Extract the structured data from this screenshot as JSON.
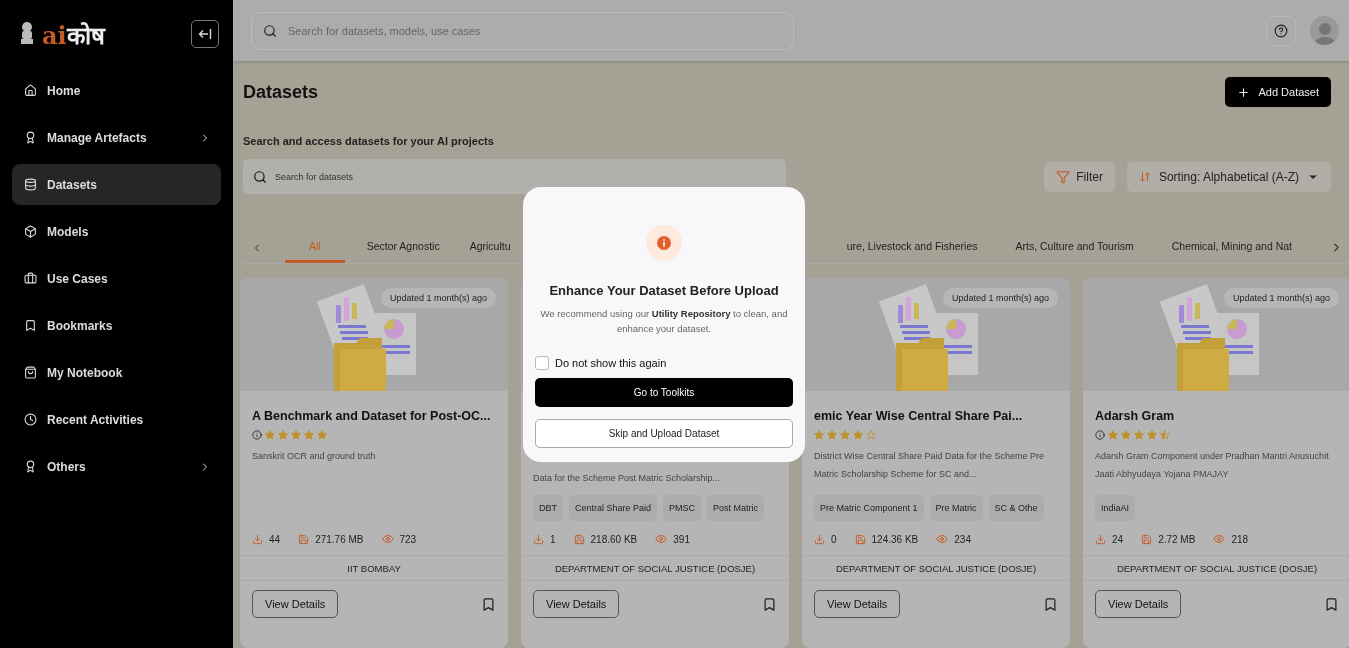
{
  "logo": {
    "prefix": "ai",
    "suffix": "कोष"
  },
  "sidebar": {
    "items": [
      {
        "label": "Home",
        "submenu": false,
        "selected": false
      },
      {
        "label": "Manage Artefacts",
        "submenu": true,
        "selected": false
      },
      {
        "label": "Datasets",
        "submenu": false,
        "selected": true
      },
      {
        "label": "Models",
        "submenu": false,
        "selected": false
      },
      {
        "label": "Use Cases",
        "submenu": false,
        "selected": false
      },
      {
        "label": "Bookmarks",
        "submenu": false,
        "selected": false
      },
      {
        "label": "My Notebook",
        "submenu": false,
        "selected": false
      },
      {
        "label": "Recent Activities",
        "submenu": false,
        "selected": false
      },
      {
        "label": "Others",
        "submenu": true,
        "selected": false
      }
    ]
  },
  "topbar": {
    "search": {
      "placeholder": "Search for datasets, models, use cases"
    }
  },
  "page": {
    "title": "Datasets",
    "subtitle": "Search and access datasets for your AI projects",
    "add_button": "Add Dataset",
    "search": {
      "placeholder": "Search for datasets"
    },
    "filter_button": "Filter",
    "sorting": {
      "label": "Sorting:",
      "value": "Alphabetical (A-Z)"
    }
  },
  "tabs": {
    "left": [
      {
        "label": "All",
        "selected": true
      },
      {
        "label": "Sector Agnostic",
        "selected": false
      },
      {
        "label": "Agricultu",
        "selected": false
      }
    ],
    "right": [
      {
        "label": "ure, Livestock and Fisheries",
        "selected": false
      },
      {
        "label": "Arts, Culture and Tourism",
        "selected": false
      },
      {
        "label": "Chemical, Mining and Nat",
        "selected": false
      }
    ]
  },
  "cards": [
    {
      "badge": "Updated 1 month(s) ago",
      "title": "A Benchmark and Dataset for Post-OC...",
      "info": true,
      "stars": 5,
      "description": "Sanskrit OCR and ground truth",
      "downloads": "44",
      "size": "271.76 MB",
      "views": "723",
      "organization": "IIT BOMBAY",
      "button": "View Details"
    },
    {
      "description": "Data for the Scheme Post Matric Scholarship...",
      "tags": [
        "DBT",
        "Central Share Paid",
        "PMSC",
        "Post Matric"
      ],
      "downloads": "1",
      "size": "218.60 KB",
      "views": "391",
      "organization": "DEPARTMENT OF SOCIAL JUSTICE (DOSJE)",
      "button": "View Details"
    },
    {
      "badge": "Updated 1 month(s) ago",
      "title": "emic Year Wise Central Share Pai...",
      "info": false,
      "stars": 4,
      "description": "District Wise Central Share Paid Data for the Scheme Pre Matric Scholarship Scheme for SC and...",
      "tags": [
        "Pre Matric Component 1",
        "Pre Matric",
        "SC & Othe"
      ],
      "downloads": "0",
      "size": "124.36 KB",
      "views": "234",
      "organization": "DEPARTMENT OF SOCIAL JUSTICE (DOSJE)",
      "button": "View Details"
    },
    {
      "badge": "Updated 1 month(s) ago",
      "title": "Adarsh Gram",
      "info": true,
      "stars": 4.5,
      "description": "Adarsh Gram Component under Pradhan Mantri Anusuchit Jaati Abhyudaya Yojana PMAJAY",
      "tags": [
        "IndiaAI"
      ],
      "downloads": "24",
      "size": "2.72 MB",
      "views": "218",
      "organization": "DEPARTMENT OF SOCIAL JUSTICE (DOSJE)",
      "button": "View Details"
    }
  ],
  "modal": {
    "title": "Enhance Your Dataset Before Upload",
    "message": "We recommend using our **Utility Repository** to clean, and enhance your dataset.",
    "checkbox": {
      "label": "Do not show this again",
      "checked": false
    },
    "primary_button": "Go to Toolkits",
    "secondary_button": "Skip and Upload Dataset"
  }
}
